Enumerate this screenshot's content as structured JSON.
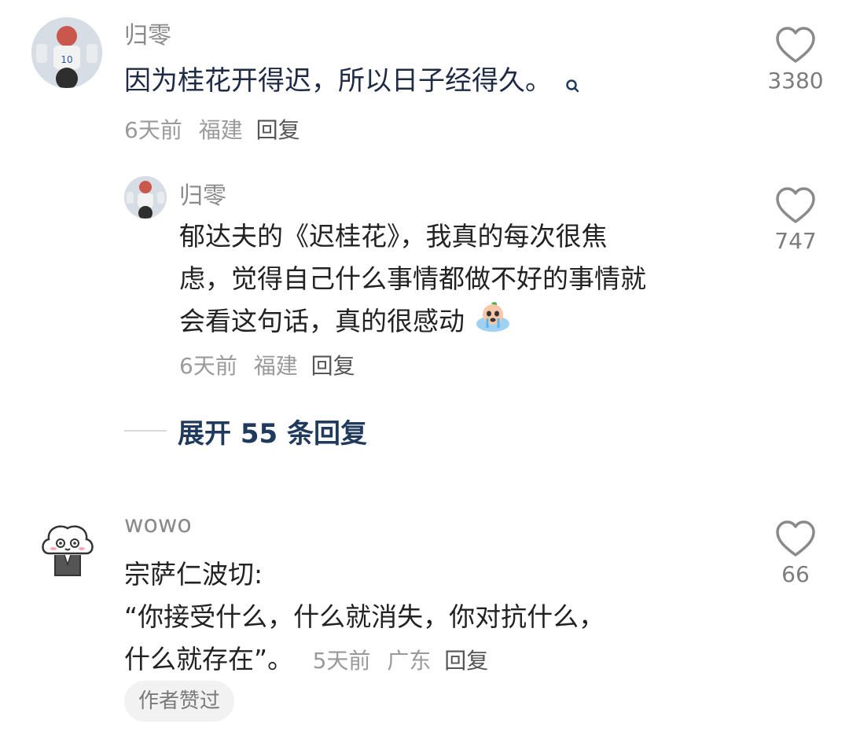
{
  "comments": [
    {
      "username": "归零",
      "text": "因为桂花开得迟，所以日子经得久。",
      "time": "6天前",
      "location": "福建",
      "reply_label": "回复",
      "likes": "3380",
      "replies": [
        {
          "username": "归零",
          "text_lines": [
            "郁达夫的《迟桂花》，我真的每次很焦",
            "虑，觉得自己什么事情都做不好的事情就",
            "会看这句话，真的很感动"
          ],
          "time": "6天前",
          "location": "福建",
          "reply_label": "回复",
          "likes": "747"
        }
      ],
      "expand_label": "展开 55 条回复"
    },
    {
      "username": "wowo",
      "text_lines": [
        "宗萨仁波切:",
        "“你接受什么，什么就消失，你对抗什么，",
        "什么就存在”。"
      ],
      "time": "5天前",
      "location": "广东",
      "reply_label": "回复",
      "likes": "66",
      "badge": "作者赞过"
    }
  ],
  "icons": {
    "like": "heart-outline-icon",
    "search": "search-icon",
    "emoji": "crying-emoji-icon"
  },
  "colors": {
    "link_text": "#1f2a44",
    "expand": "#1f3a5c",
    "meta": "#9a9a9a",
    "heart_stroke": "#8a8a8a"
  }
}
